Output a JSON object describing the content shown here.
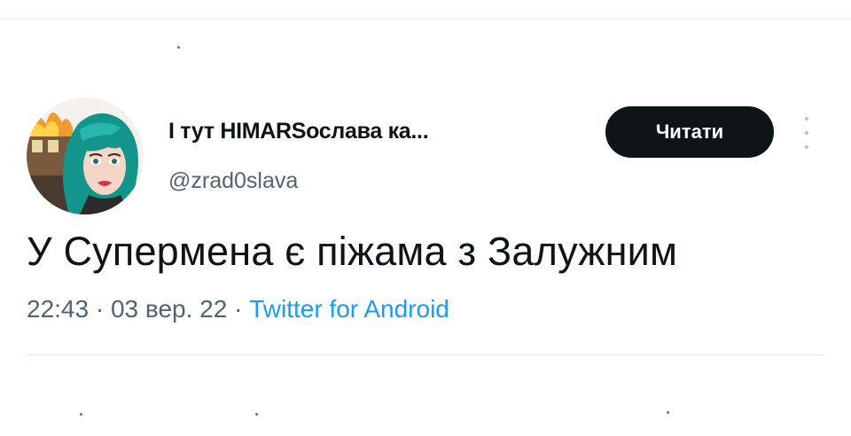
{
  "tweet": {
    "display_name": "І тут HIMARSослава ка...",
    "handle": "@zrad0slava",
    "read_button_label": "Читати",
    "text": "У Супермена є піжама з Залужним",
    "time": "22:43",
    "separator": "·",
    "date": "03 вер. 22",
    "source": "Twitter for Android"
  },
  "icons": {
    "avatar": "user-avatar-image",
    "more": "more-vertical-icon"
  },
  "colors": {
    "text": "#0f1419",
    "secondary": "#536471",
    "link": "#1d9bf0",
    "button_bg": "#0f1419",
    "button_text": "#ffffff",
    "avatar_hair": "#1aa39b"
  }
}
